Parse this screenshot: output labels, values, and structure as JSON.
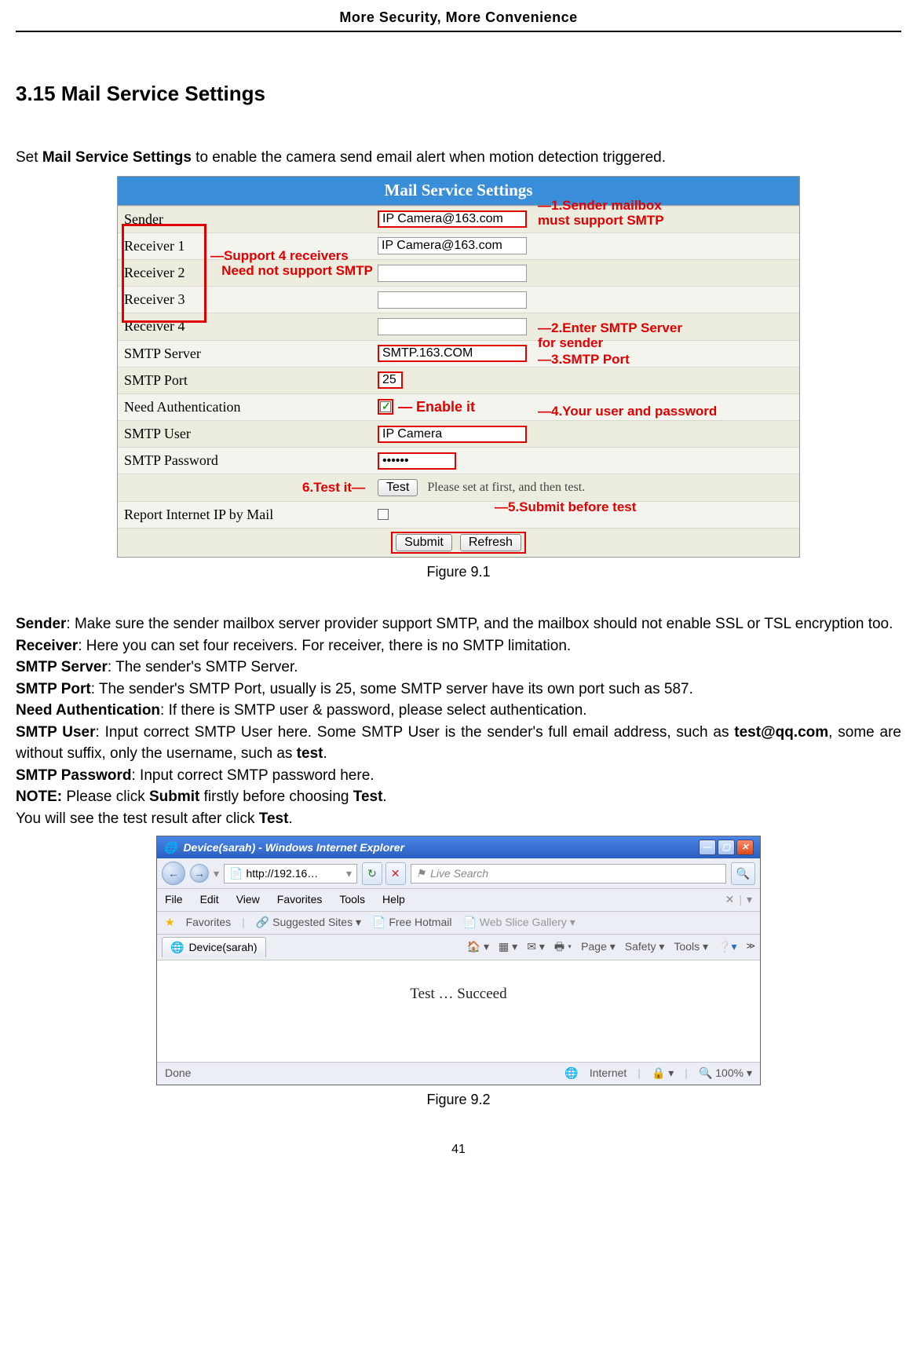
{
  "header": "More Security, More Convenience",
  "section_title": "3.15 Mail Service Settings",
  "intro_prefix": "Set ",
  "intro_bold": "Mail Service Settings",
  "intro_suffix": " to enable the camera send email alert when motion detection triggered.",
  "mail": {
    "title": "Mail Service Settings",
    "rows": {
      "sender": {
        "label": "Sender",
        "value": "IP Camera@163.com"
      },
      "recv1": {
        "label": "Receiver 1",
        "value": "IP Camera@163.com"
      },
      "recv2": {
        "label": "Receiver 2",
        "value": ""
      },
      "recv3": {
        "label": "Receiver 3",
        "value": ""
      },
      "recv4": {
        "label": "Receiver 4",
        "value": ""
      },
      "server": {
        "label": "SMTP Server",
        "value": "SMTP.163.COM"
      },
      "port": {
        "label": "SMTP Port",
        "value": "25"
      },
      "auth": {
        "label": "Need Authentication"
      },
      "user": {
        "label": "SMTP User",
        "value": "IP Camera"
      },
      "pass": {
        "label": "SMTP Password",
        "value": "••••••"
      },
      "test_btn": "Test",
      "test_note": "Please set at first, and then test.",
      "report": {
        "label": "Report Internet IP by Mail"
      },
      "submit": "Submit",
      "refresh": "Refresh"
    },
    "ann": {
      "a1": "1.Sender mailbox must support SMTP",
      "recv_l1": "Support 4 receivers",
      "recv_l2": "Need not support SMTP",
      "a2": "2.Enter SMTP Server for sender",
      "a3": "3.SMTP Port",
      "enable": "Enable it",
      "a4": "4.Your user and password",
      "a5": "5.Submit before test",
      "a6": "6.Test it"
    }
  },
  "fig1_caption": "Figure 9.1",
  "desc": {
    "sender_b": "Sender",
    "sender_t": ": Make sure the sender mailbox server provider support SMTP, and the mailbox should not enable SSL or TSL encryption too.",
    "receiver_b": "Receiver",
    "receiver_t": ": Here you can set four receivers. For receiver, there is no SMTP limitation.",
    "server_b": "SMTP Server",
    "server_t": ": The sender's SMTP Server.",
    "port_b": "SMTP Port",
    "port_t": ": The sender's SMTP Port, usually is 25, some SMTP server have its own port such as 587.",
    "auth_b": "Need Authentication",
    "auth_t": ": If there is SMTP user & password, please select authentication.",
    "user_b": "SMTP User",
    "user_t1": ": Input correct SMTP User here. Some SMTP User is the sender's full email address, such as ",
    "user_t2": "test@qq.com",
    "user_t3": ", some are without suffix, only the username, such as ",
    "user_t4": "test",
    "user_t5": ".",
    "pass_b": "SMTP Password",
    "pass_t": ": Input correct SMTP password here.",
    "note_b": "NOTE:",
    "note_t1": " Please click ",
    "note_t2": "Submit",
    "note_t3": " firstly before choosing ",
    "note_t4": "Test",
    "note_t5": ".",
    "post_t1": "You will see the test result after click ",
    "post_t2": "Test",
    "post_t3": "."
  },
  "ie": {
    "title": "Device(sarah) - Windows Internet Explorer",
    "url": "http://192.16…",
    "search_placeholder": "Live Search",
    "menu": {
      "file": "File",
      "edit": "Edit",
      "view": "View",
      "favorites": "Favorites",
      "tools": "Tools",
      "help": "Help"
    },
    "fav_label": "Favorites",
    "fav_suggested": "Suggested Sites",
    "fav_hotmail": "Free Hotmail",
    "fav_slice": "Web Slice Gallery",
    "tab": "Device(sarah)",
    "tools_page": "Page",
    "tools_safety": "Safety",
    "tools_tools": "Tools",
    "body": "Test  …  Succeed",
    "status_left": "Done",
    "status_internet": "Internet",
    "zoom": "100%"
  },
  "fig2_caption": "Figure 9.2",
  "page_no": "41"
}
